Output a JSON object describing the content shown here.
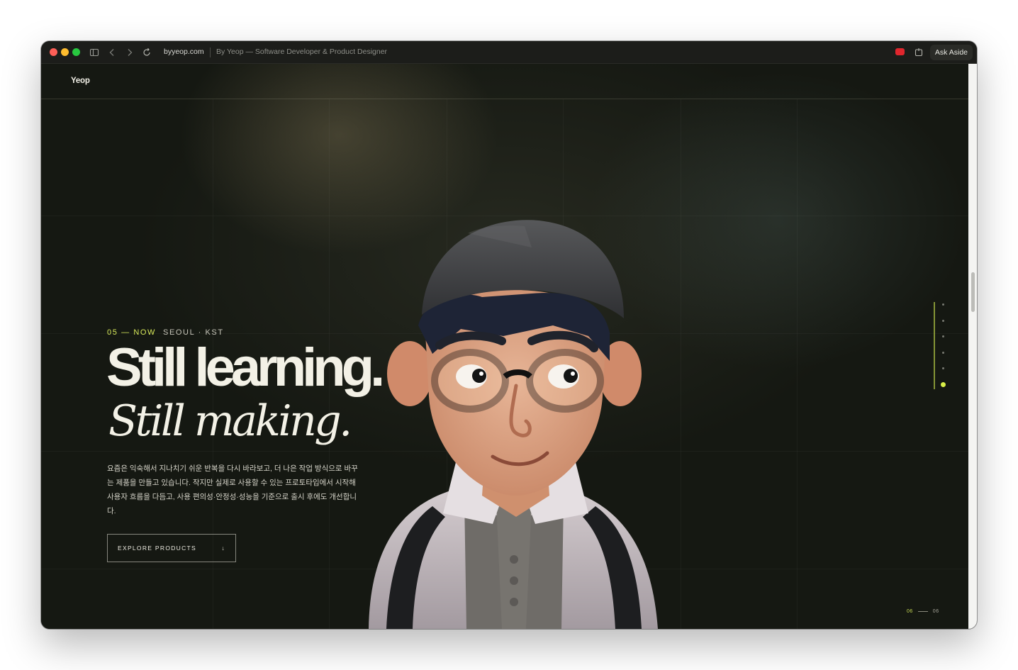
{
  "browser": {
    "url": "byyeop.com",
    "page_title": "By Yeop — Software Developer & Product Designer",
    "ask_button": "Ask Aside"
  },
  "site": {
    "brand": "Yeop"
  },
  "hero": {
    "eyebrow_num": "05 — NOW",
    "eyebrow_loc": "SEOUL · KST",
    "headline_1": "Still learning.",
    "headline_2": "Still making.",
    "description": "요즘은 익숙해서 지나치기 쉬운 반복을 다시 바라보고, 더 나은 작업 방식으로 바꾸는 제품을 만들고 있습니다. 작지만 실제로 사용할 수 있는 프로토타입에서 시작해 사용자 흐름을 다듬고, 사용 편의성·안정성·성능을 기준으로 출시 후에도 개선합니다.",
    "cta_label": "EXPLORE PRODUCTS",
    "cta_icon": "↓"
  },
  "section_nav": {
    "count": 6,
    "active_index": 5,
    "accent": "#d8ef48"
  },
  "pager": {
    "current": "06",
    "total": "06"
  },
  "colors": {
    "background": "#151812",
    "text": "#f3f1e6",
    "accent": "#d8ea5a"
  }
}
